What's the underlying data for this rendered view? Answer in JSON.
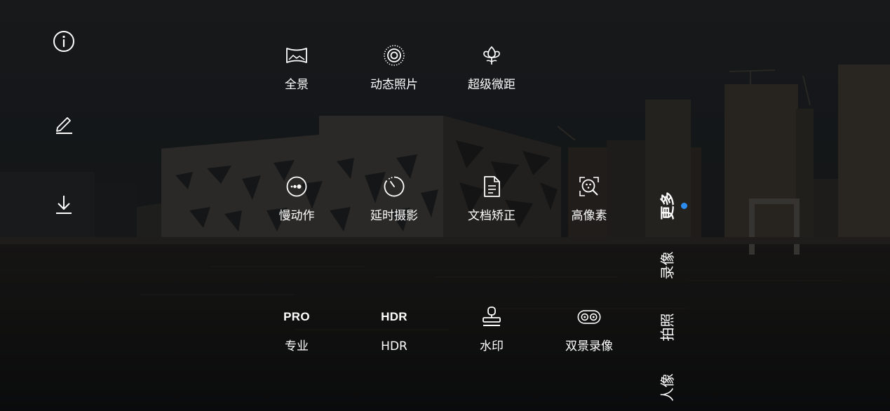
{
  "sidebar": {
    "info_icon": "info-icon",
    "edit_icon": "edit-pencil-icon",
    "download_icon": "download-icon"
  },
  "modes": [
    {
      "label": "全景",
      "icon": "panorama-icon"
    },
    {
      "label": "动态照片",
      "icon": "moving-picture-icon"
    },
    {
      "label": "超级微距",
      "icon": "flower-macro-icon"
    },
    {
      "label": "慢动作",
      "icon": "slow-motion-icon"
    },
    {
      "label": "延时摄影",
      "icon": "time-lapse-icon"
    },
    {
      "label": "文档矫正",
      "icon": "document-icon"
    },
    {
      "label": "高像素",
      "icon": "high-resolution-icon"
    },
    {
      "label": "专业",
      "icon": "pro-icon",
      "icon_text": "PRO"
    },
    {
      "label": "HDR",
      "icon": "hdr-icon",
      "icon_text": "HDR"
    },
    {
      "label": "水印",
      "icon": "watermark-stamp-icon"
    },
    {
      "label": "双景录像",
      "icon": "dual-view-icon"
    }
  ],
  "mode_tabs": [
    {
      "label": "更多",
      "active": true
    },
    {
      "label": "录像",
      "active": false
    },
    {
      "label": "拍照",
      "active": false
    },
    {
      "label": "人像",
      "active": false
    }
  ],
  "colors": {
    "accent": "#2d8cf0",
    "overlay": "#16181a",
    "text": "#ffffff"
  }
}
